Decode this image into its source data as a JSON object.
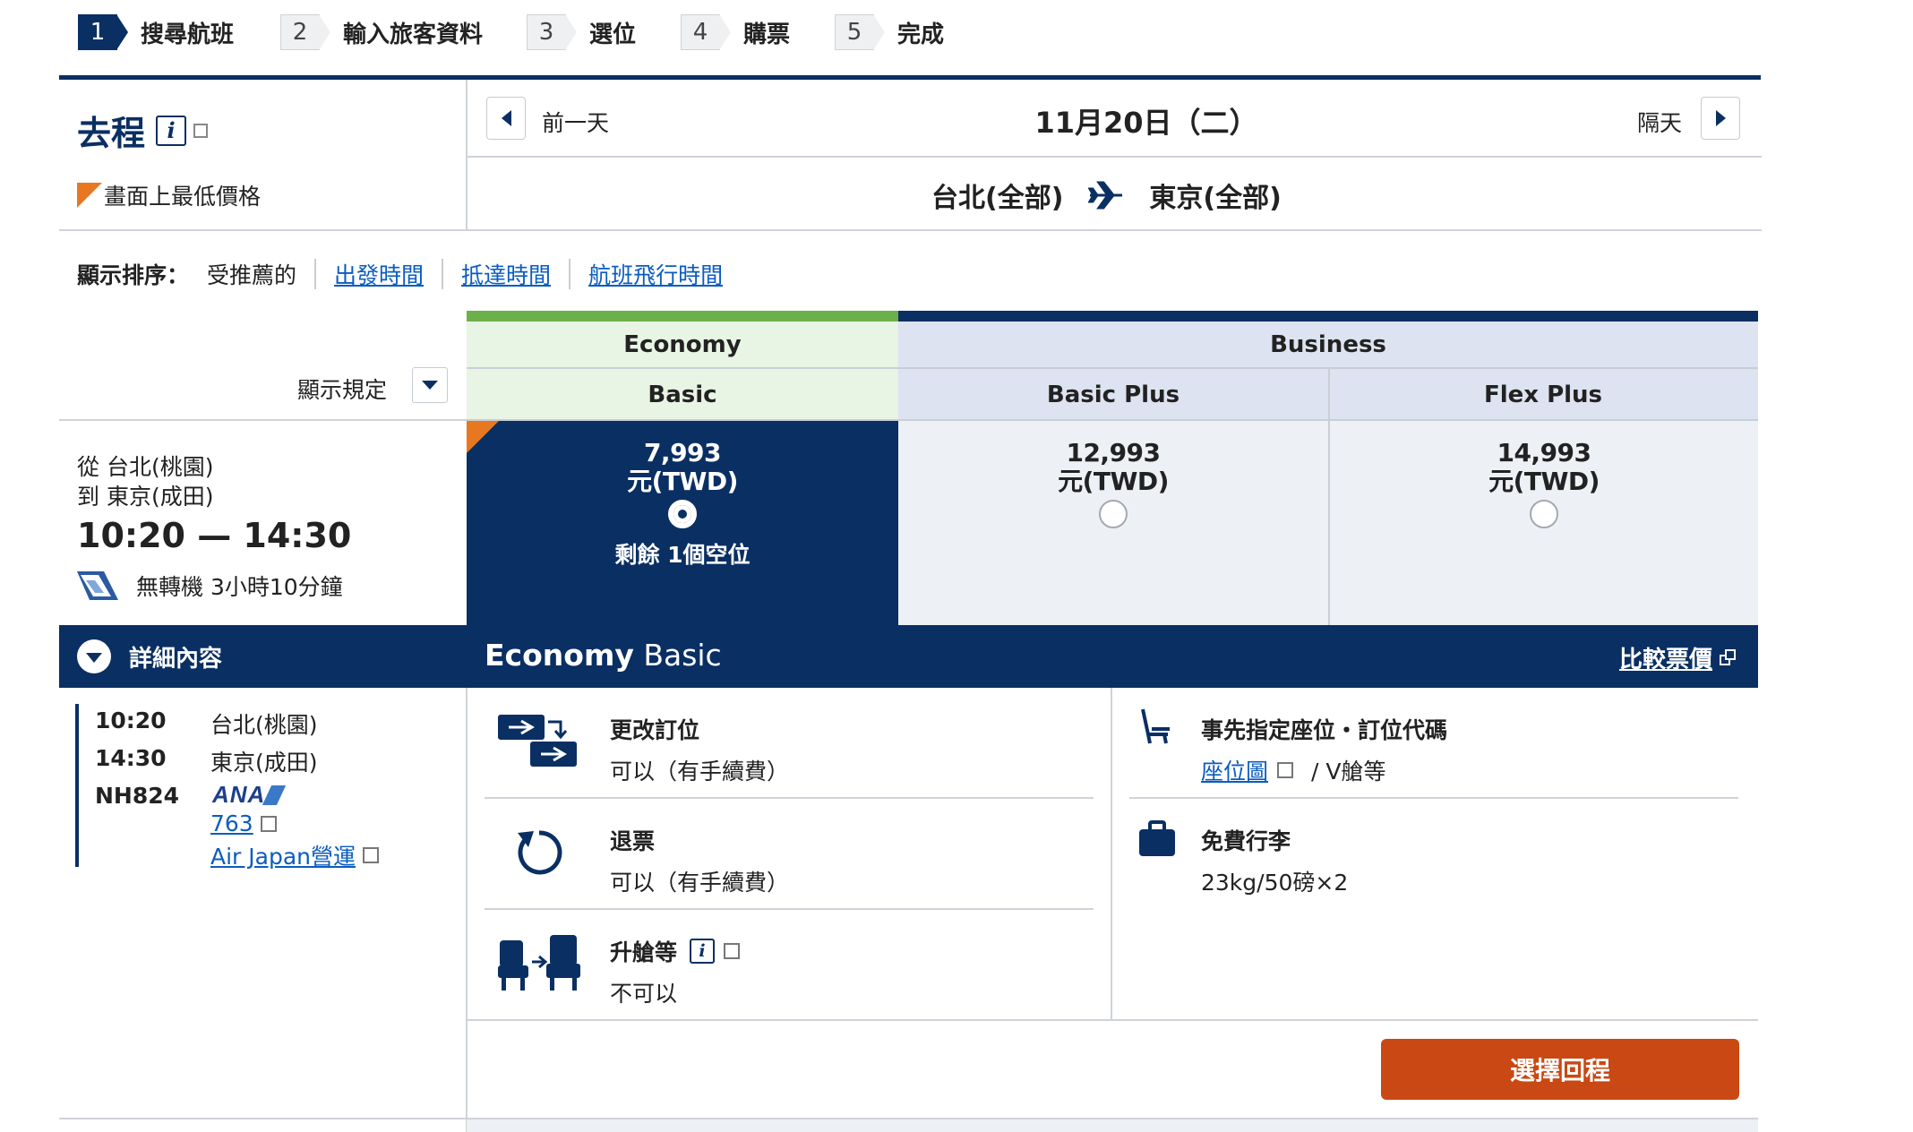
{
  "steps": [
    {
      "num": "1",
      "label": "搜尋航班"
    },
    {
      "num": "2",
      "label": "輸入旅客資料"
    },
    {
      "num": "3",
      "label": "選位"
    },
    {
      "num": "4",
      "label": "購票"
    },
    {
      "num": "5",
      "label": "完成"
    }
  ],
  "direction": {
    "title": "去程",
    "info_icon_text": "i"
  },
  "lowest_price_note": "畫面上最低價格",
  "date_nav": {
    "prev_label": "前一天",
    "date": "11月20日（二）",
    "next_label": "隔天"
  },
  "route": {
    "from": "台北(全部)",
    "to": "東京(全部)"
  },
  "sort": {
    "label": "顯示排序：",
    "current": "受推薦的",
    "options": [
      "出發時間",
      "抵達時間",
      "航班飛行時間"
    ]
  },
  "rules_label": "顯示規定",
  "cabins": {
    "economy": {
      "name": "Economy",
      "fares": [
        "Basic"
      ]
    },
    "business": {
      "name": "Business",
      "fares": [
        "Basic Plus",
        "Flex Plus"
      ]
    }
  },
  "flight": {
    "from_line": "從 台北(桃園)",
    "to_line": "到 東京(成田)",
    "times": "10:20 — 14:30",
    "stops_duration": "無轉機 3小時10分鐘",
    "details_label": "詳細內容",
    "dep_time": "10:20",
    "dep_airport": "台北(桃園)",
    "arr_time": "14:30",
    "arr_airport": "東京(成田)",
    "flight_no": "NH824",
    "airline_logo_text": "ANA",
    "aircraft": "763",
    "operator": "Air Japan營運"
  },
  "fares": [
    {
      "price": "7,993",
      "currency": "元(TWD)",
      "seats_left": "剩餘 1個空位",
      "selected": true
    },
    {
      "price": "12,993",
      "currency": "元(TWD)",
      "selected": false
    },
    {
      "price": "14,993",
      "currency": "元(TWD)",
      "selected": false
    }
  ],
  "fare_detail": {
    "title_bold": "Economy",
    "title_rest": " Basic",
    "compare_label": "比較票價",
    "change": {
      "title": "更改訂位",
      "value": "可以（有手續費）"
    },
    "refund": {
      "title": "退票",
      "value": "可以（有手續費）"
    },
    "upgrade": {
      "title": "升艙等",
      "value": "不可以"
    },
    "seat": {
      "title": "事先指定座位・訂位代碼",
      "link": "座位圖",
      "value": "/ V艙等"
    },
    "baggage": {
      "title": "免費行李",
      "value": "23kg/50磅×2"
    }
  },
  "select_return_label": "選擇回程",
  "colors": {
    "navy": "#0a2f63",
    "economy_bar": "#6cb04a",
    "economy_bg": "#e8f4e4",
    "business_bg": "#dde3f1",
    "fare_bg": "#edf0f5",
    "button": "#c94813",
    "link": "#0b5cc0"
  }
}
